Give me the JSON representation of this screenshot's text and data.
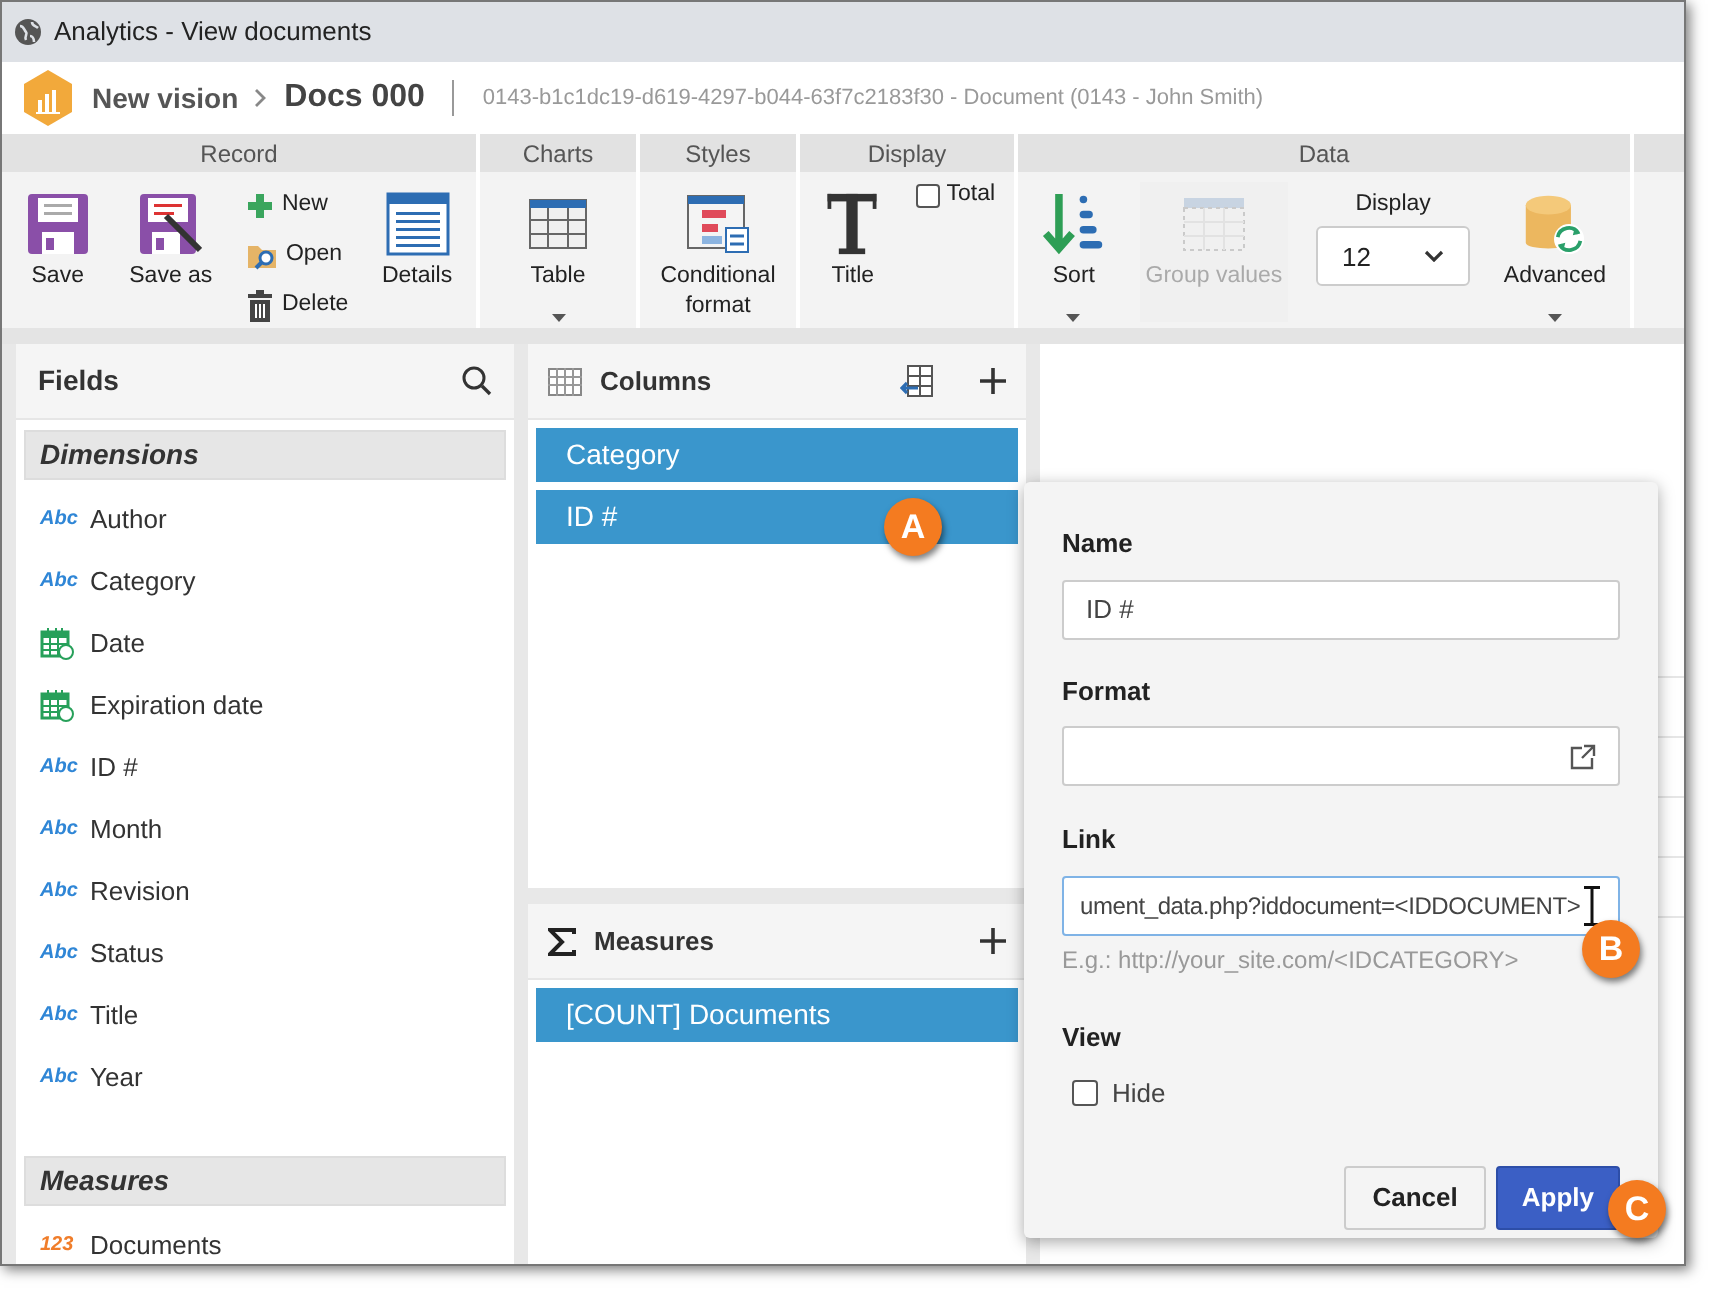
{
  "window": {
    "title": "Analytics - View documents"
  },
  "header": {
    "breadcrumb": [
      "New vision",
      "Docs 000"
    ],
    "subtitle": "0143-b1c1dc19-d619-4297-b044-63f7c2183f30 - Document (0143 - John Smith)"
  },
  "ribbon": {
    "groups": [
      {
        "label": "Record",
        "buttons": [
          {
            "kind": "large",
            "label": "Save",
            "dropdown": false,
            "disabled": false
          },
          {
            "kind": "large",
            "label": "Save as",
            "dropdown": false,
            "disabled": false
          },
          {
            "kind": "stack",
            "items": [
              {
                "label": "New"
              },
              {
                "label": "Open"
              },
              {
                "label": "Delete"
              }
            ]
          },
          {
            "kind": "large",
            "label": "Details",
            "dropdown": false,
            "disabled": false
          }
        ]
      },
      {
        "label": "Charts",
        "buttons": [
          {
            "kind": "large",
            "label": "Table",
            "dropdown": true,
            "disabled": false
          }
        ]
      },
      {
        "label": "Styles",
        "buttons": [
          {
            "kind": "large",
            "label": "Conditional format",
            "dropdown": false,
            "disabled": false
          }
        ]
      },
      {
        "label": "Display",
        "buttons": [
          {
            "kind": "large",
            "label": "Title",
            "dropdown": false,
            "disabled": false
          },
          {
            "kind": "checkbox",
            "label": "Total",
            "checked": false
          }
        ]
      },
      {
        "label": "Data",
        "buttons": [
          {
            "kind": "large",
            "label": "Sort",
            "dropdown": true,
            "disabled": false
          },
          {
            "kind": "large",
            "label": "Group values",
            "dropdown": false,
            "disabled": true
          },
          {
            "kind": "select",
            "label": "Display",
            "value": "12"
          },
          {
            "kind": "large",
            "label": "Advanced",
            "dropdown": true,
            "disabled": false
          }
        ]
      }
    ]
  },
  "fields": {
    "title": "Fields",
    "sections": [
      {
        "title": "Dimensions",
        "items": [
          {
            "kind": "text",
            "tag": "Abc",
            "label": "Author"
          },
          {
            "kind": "text",
            "tag": "Abc",
            "label": "Category"
          },
          {
            "kind": "date",
            "label": "Date"
          },
          {
            "kind": "date",
            "label": "Expiration date"
          },
          {
            "kind": "text",
            "tag": "Abc",
            "label": "ID #"
          },
          {
            "kind": "text",
            "tag": "Abc",
            "label": "Month"
          },
          {
            "kind": "text",
            "tag": "Abc",
            "label": "Revision"
          },
          {
            "kind": "text",
            "tag": "Abc",
            "label": "Status"
          },
          {
            "kind": "text",
            "tag": "Abc",
            "label": "Title"
          },
          {
            "kind": "text",
            "tag": "Abc",
            "label": "Year"
          }
        ]
      },
      {
        "title": "Measures",
        "items": [
          {
            "kind": "number",
            "tag": "123",
            "label": "Documents"
          }
        ]
      }
    ]
  },
  "columns": {
    "title": "Columns",
    "items": [
      {
        "label": "Category"
      },
      {
        "label": "ID #"
      }
    ]
  },
  "measures": {
    "title": "Measures",
    "items": [
      {
        "label": "[COUNT] Documents"
      }
    ]
  },
  "dialog": {
    "name_label": "Name",
    "name_value": "ID #",
    "format_label": "Format",
    "link_label": "Link",
    "link_value": "ument_data.php?iddocument=<IDDOCUMENT>",
    "link_hint": "E.g.: http://your_site.com/<IDCATEGORY>",
    "view_label": "View",
    "hide": {
      "label": "Hide",
      "checked": false
    },
    "buttons": [
      "Cancel",
      "Apply"
    ]
  },
  "callouts": [
    "A",
    "B",
    "C"
  ]
}
